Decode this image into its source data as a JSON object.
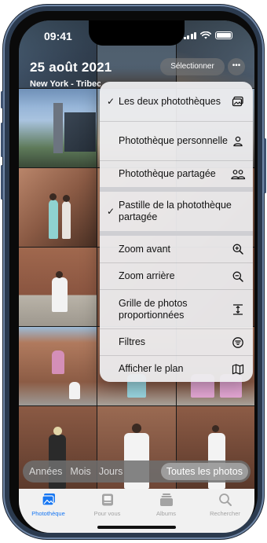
{
  "status_bar": {
    "time": "09:41"
  },
  "header": {
    "title": "25 août 2021",
    "subtitle": "New York - Tribeca",
    "select_label": "Sélectionner",
    "more_label": "•••"
  },
  "menu": {
    "items": [
      {
        "label": "Les deux photothèques",
        "checked": true,
        "icon": "photo-stack-icon"
      },
      {
        "label": "Photothèque personnelle",
        "checked": false,
        "icon": "person-icon"
      },
      {
        "label": "Photothèque partagée",
        "checked": false,
        "icon": "two-people-icon"
      },
      {
        "label": "Pastille de la photothèque partagée",
        "checked": true,
        "icon": ""
      },
      {
        "label": "Zoom avant",
        "checked": false,
        "icon": "zoom-in-icon"
      },
      {
        "label": "Zoom arrière",
        "checked": false,
        "icon": "zoom-out-icon"
      },
      {
        "label": "Grille de photos proportionnées",
        "checked": false,
        "icon": "aspect-ratio-icon"
      },
      {
        "label": "Filtres",
        "checked": false,
        "icon": "filter-icon"
      },
      {
        "label": "Afficher le plan",
        "checked": false,
        "icon": "map-icon"
      }
    ],
    "check_glyph": "✓"
  },
  "segments": {
    "items": [
      "Années",
      "Mois",
      "Jours",
      "Toutes les photos"
    ],
    "active": "Toutes les photos"
  },
  "tabbar": {
    "items": [
      {
        "label": "Photothèque",
        "active": true
      },
      {
        "label": "Pour vous",
        "active": false
      },
      {
        "label": "Albums",
        "active": false
      },
      {
        "label": "Rechercher",
        "active": false
      }
    ]
  },
  "colors": {
    "accent": "#1877f2",
    "menu_bg": "#ececee",
    "tab_inactive": "#a3a3a3"
  }
}
